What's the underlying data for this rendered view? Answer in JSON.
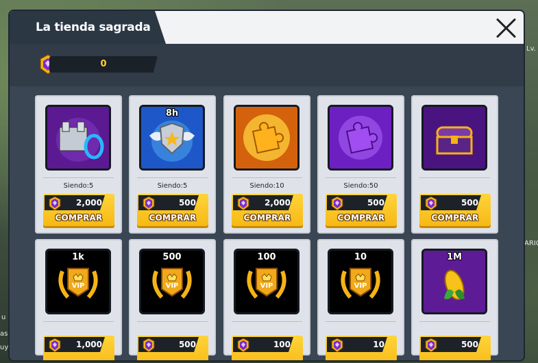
{
  "window": {
    "title": "La tienda sagrada"
  },
  "currency": {
    "value": "0",
    "icon": "holy-gem-icon"
  },
  "background": {
    "texts": [
      "Lv.",
      "ARIC",
      "u",
      "as.",
      "uy"
    ]
  },
  "items": [
    {
      "name": "castle-portal",
      "label": "",
      "stock": "Siendo:5",
      "price": "2,000",
      "buy": "COMPRAR",
      "frame": "#6a1ea0"
    },
    {
      "name": "shield-wings",
      "label": "8h",
      "stock": "Siendo:5",
      "price": "500",
      "buy": "COMPRAR",
      "frame": "#1c4fc4"
    },
    {
      "name": "gold-puzzle",
      "label": "",
      "stock": "Siendo:10",
      "price": "2,000",
      "buy": "COMPRAR",
      "frame": "#e07a10"
    },
    {
      "name": "purple-puzzle",
      "label": "",
      "stock": "Siendo:50",
      "price": "500",
      "buy": "COMPRAR",
      "frame": "#7a22c8"
    },
    {
      "name": "treasure-chest",
      "label": "",
      "stock": "",
      "price": "500",
      "buy": "COMPRAR",
      "frame": "#5a1a90"
    },
    {
      "name": "vip-1k",
      "label": "1k",
      "stock": "",
      "price": "1,000",
      "buy": "",
      "frame": "#6a1ea0"
    },
    {
      "name": "vip-500",
      "label": "500",
      "stock": "",
      "price": "500",
      "buy": "",
      "frame": "#1c4fc4"
    },
    {
      "name": "vip-100",
      "label": "100",
      "stock": "",
      "price": "100",
      "buy": "",
      "frame": "#1a63b8"
    },
    {
      "name": "vip-10",
      "label": "10",
      "stock": "",
      "price": "10",
      "buy": "",
      "frame": "#3a4a62"
    },
    {
      "name": "corn-1m",
      "label": "1M",
      "stock": "",
      "price": "500",
      "buy": "",
      "frame": "#6a1ea0"
    }
  ]
}
